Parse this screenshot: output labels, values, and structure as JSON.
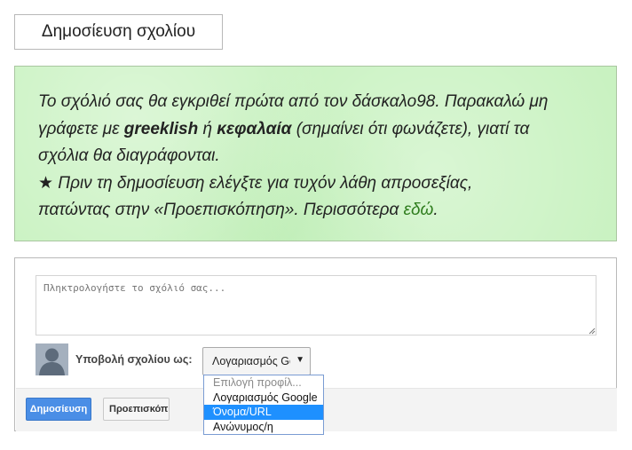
{
  "top_button": {
    "label": "Δημοσίευση σχολίου"
  },
  "notice": {
    "line1_a": "Το σχόλιό σας θα εγκριθεί πρώτα από τον δάσκαλο98. Παρακαλώ μη",
    "line2_a": "γράφετε με ",
    "line2_b": "greeklish",
    "line2_c": " ή ",
    "line2_d": "κεφαλαία",
    "line2_e": " (σημαίνει ότι φωνάζετε), γιατί τα",
    "line3": "σχόλια θα διαγράφονται.",
    "line4": "★ Πριν τη δημοσίευση ελέγξτε για τυχόν λάθη απροσεξίας,",
    "line5_a": "πατώντας στην «Προεπισκόπηση». Περισσότερα ",
    "line5_link": "εδώ",
    "line5_end": "."
  },
  "comment": {
    "placeholder": "Πληκτρολογήστε το σχόλιό σας...",
    "comment_as_label": "Υποβολή σχολίου ως:",
    "identity_selected": "Λογαριασμός Google",
    "identity_options": [
      {
        "label": "Επιλογή προφίλ...",
        "state": "disabled"
      },
      {
        "label": "Λογαριασμός Google",
        "state": "normal"
      },
      {
        "label": "Όνομα/URL",
        "state": "selected"
      },
      {
        "label": "Ανώνυμος/η",
        "state": "normal"
      }
    ],
    "publish_label": "Δημοσίευση",
    "preview_label": "Προεπισκόπηση"
  },
  "colors": {
    "notice_bg": "#c9f2c1",
    "notice_link": "#2f7d1e",
    "publish_button": "#4a8ee6",
    "dropdown_highlight": "#1e90ff"
  }
}
